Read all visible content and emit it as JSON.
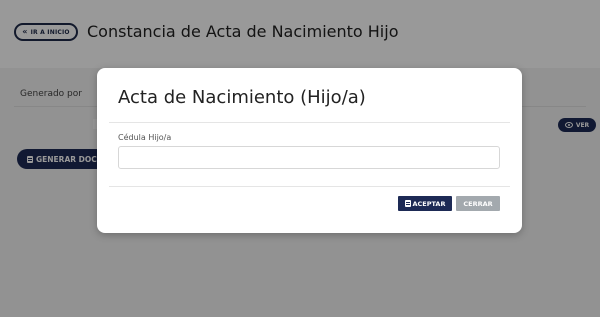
{
  "header": {
    "back_label": "IR A INICIO",
    "back_icon": "double-chevron-left-icon",
    "title": "Constancia de Acta de Nacimiento Hijo"
  },
  "filters": {
    "generated_by_label": "Generado por"
  },
  "actions": {
    "generate_label": "GENERAR DOC",
    "view_label": "VER"
  },
  "modal": {
    "title": "Acta de Nacimiento (Hijo/a)",
    "field_label": "Cédula Hijo/a",
    "field_value": "",
    "accept_label": "ACEPTAR",
    "close_label": "CERRAR"
  },
  "colors": {
    "primary": "#1d2a55",
    "secondary": "#a3a9ae",
    "overlay": "rgba(0,0,0,0.4)"
  }
}
